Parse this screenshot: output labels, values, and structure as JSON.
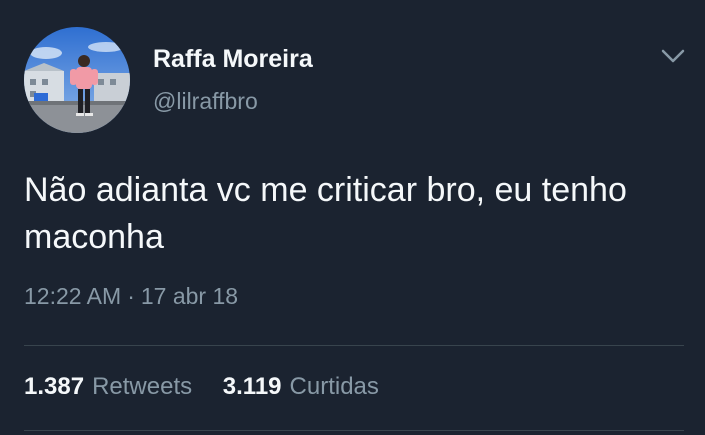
{
  "user": {
    "display_name": "Raffa Moreira",
    "handle": "@lilraffbro",
    "avatar_icon": "profile-photo"
  },
  "tweet": {
    "text": "Não adianta vc me criticar bro, eu tenho maconha",
    "time": "12:22 AM",
    "separator": "·",
    "date": "17 abr 18"
  },
  "stats": {
    "retweets_count": "1.387",
    "retweets_label": "Retweets",
    "likes_count": "3.119",
    "likes_label": "Curtidas"
  },
  "colors": {
    "background": "#1b2330",
    "primary_text": "#f5f8fa",
    "secondary_text": "#8899a6",
    "divider": "#38444d"
  }
}
